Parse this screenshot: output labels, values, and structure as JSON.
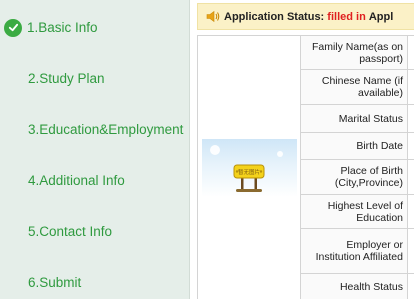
{
  "sidebar": {
    "steps": [
      {
        "label": "1.Basic Info",
        "completed": true
      },
      {
        "label": "2.Study Plan",
        "completed": false
      },
      {
        "label": "3.Education&Employment",
        "completed": false
      },
      {
        "label": "4.Additional Info",
        "completed": false
      },
      {
        "label": "5.Contact Info",
        "completed": false
      },
      {
        "label": "6.Submit",
        "completed": false
      }
    ]
  },
  "status": {
    "label": "Application Status:",
    "value": "filled in",
    "trailing": "Appl"
  },
  "photo": {
    "sign_text": "暂无图片"
  },
  "form": {
    "fields": [
      "Family Name(as on passport)",
      "Chinese Name (if available)",
      "Marital Status",
      "Birth Date",
      "Place of Birth (City,Province)",
      "Highest Level of Education",
      "Employer or Institution Affiliated",
      "Health Status"
    ]
  },
  "colors": {
    "sidebar_bg": "#e5eee9",
    "step_text": "#2f9a3f",
    "check": "#3bab43",
    "status_bg": "#fbf1c7",
    "status_value": "#e02020"
  }
}
